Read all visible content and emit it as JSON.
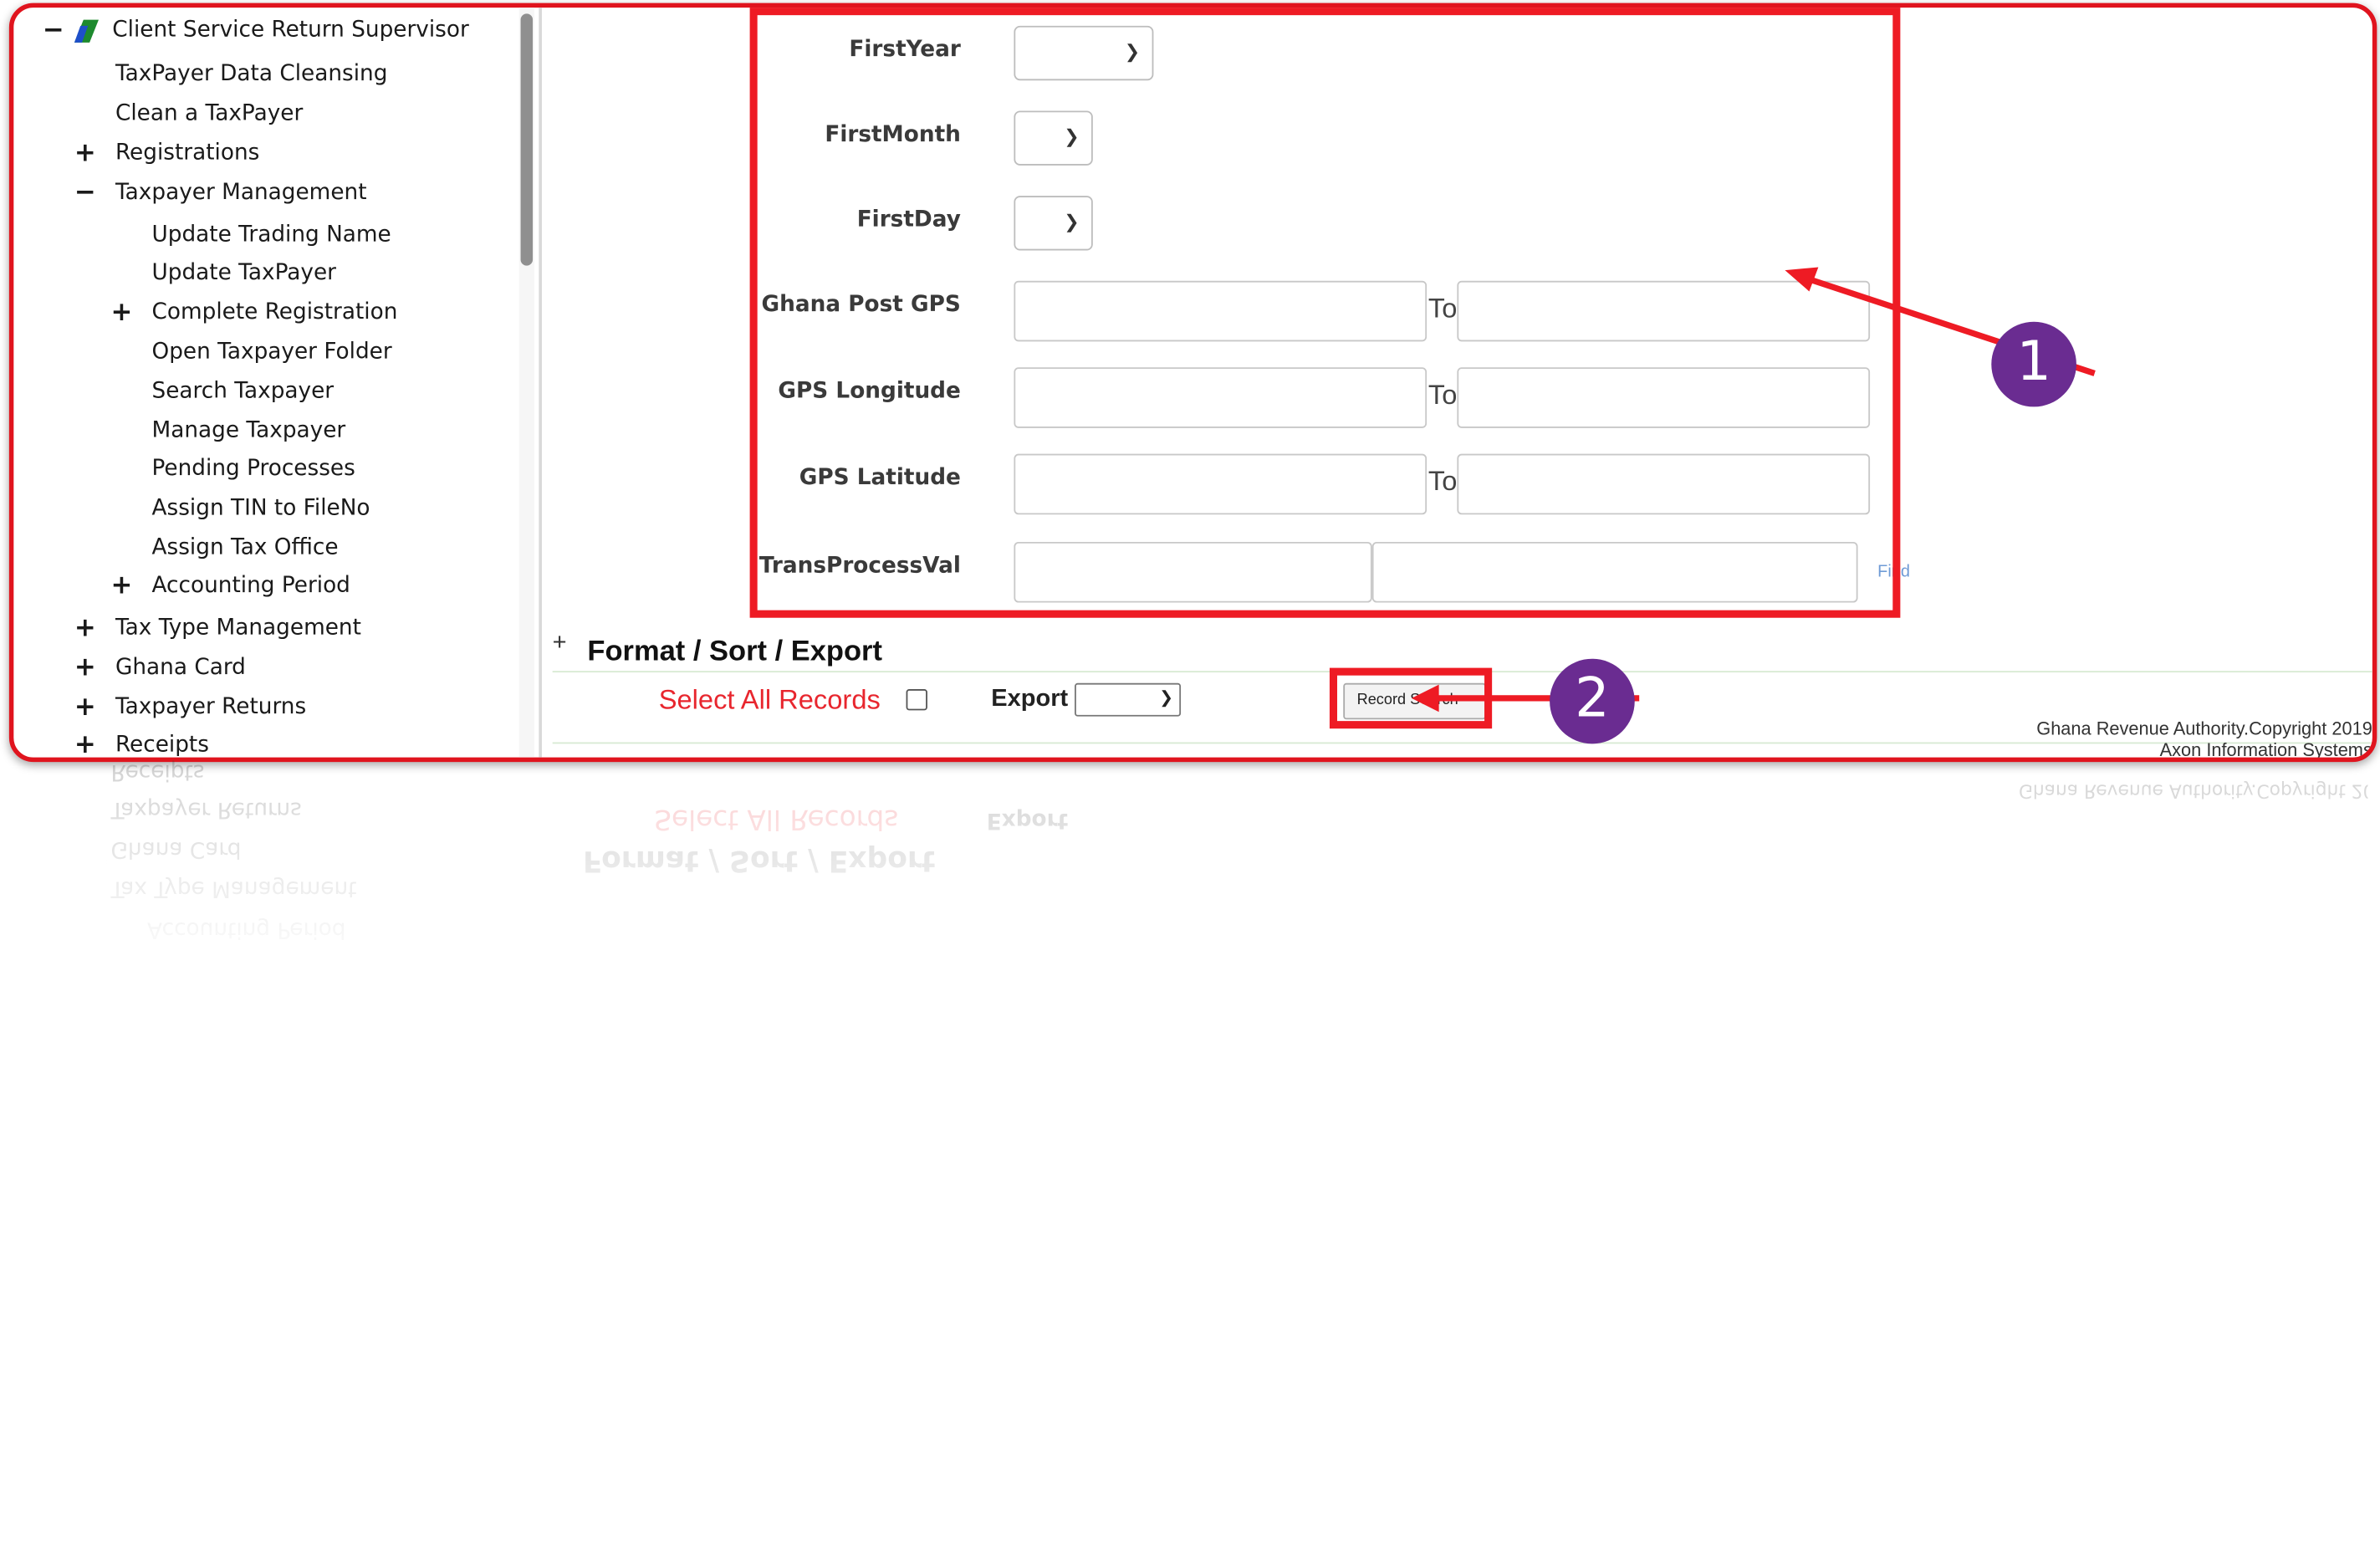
{
  "sidebar": {
    "root_sign": "−",
    "root_label": "Client Service Return Supervisor",
    "items": [
      {
        "sign": "",
        "label": "TaxPayer Data Cleansing"
      },
      {
        "sign": "",
        "label": "Clean a TaxPayer"
      },
      {
        "sign": "+",
        "label": "Registrations"
      },
      {
        "sign": "−",
        "label": "Taxpayer Management"
      },
      {
        "sign": "",
        "label": "Update Trading Name"
      },
      {
        "sign": "",
        "label": "Update TaxPayer"
      },
      {
        "sign": "+",
        "label": "Complete Registration"
      },
      {
        "sign": "",
        "label": "Open Taxpayer Folder"
      },
      {
        "sign": "",
        "label": "Search Taxpayer"
      },
      {
        "sign": "",
        "label": "Manage Taxpayer"
      },
      {
        "sign": "",
        "label": "Pending Processes"
      },
      {
        "sign": "",
        "label": "Assign TIN to FileNo"
      },
      {
        "sign": "",
        "label": "Assign Tax Office"
      },
      {
        "sign": "+",
        "label": "Accounting Period"
      },
      {
        "sign": "+",
        "label": "Tax Type Management"
      },
      {
        "sign": "+",
        "label": "Ghana Card"
      },
      {
        "sign": "+",
        "label": "Taxpayer Returns"
      },
      {
        "sign": "+",
        "label": "Receipts"
      }
    ]
  },
  "form": {
    "first_year_label": "FirstYear",
    "first_month_label": "FirstMonth",
    "first_day_label": "FirstDay",
    "ghana_post_gps_label": "Ghana Post GPS",
    "gps_longitude_label": "GPS Longitude",
    "gps_latitude_label": "GPS Latitude",
    "trans_process_val_label": "TransProcessVal",
    "to_label": "To",
    "find_link": "Find"
  },
  "format_section": {
    "toggle": "+",
    "title": "Format / Sort / Export",
    "select_all_label": "Select All Records",
    "export_label": "Export",
    "record_search_button": "Record Search"
  },
  "footer": {
    "copyright": "Ghana Revenue Authority.Copyright 2019",
    "vendor": "Axon Information Systems"
  },
  "callouts": {
    "one": "1",
    "two": "2"
  },
  "colors": {
    "highlight": "#ee1b24",
    "callout": "#6a2c91",
    "select_all_text": "#e8262e"
  }
}
